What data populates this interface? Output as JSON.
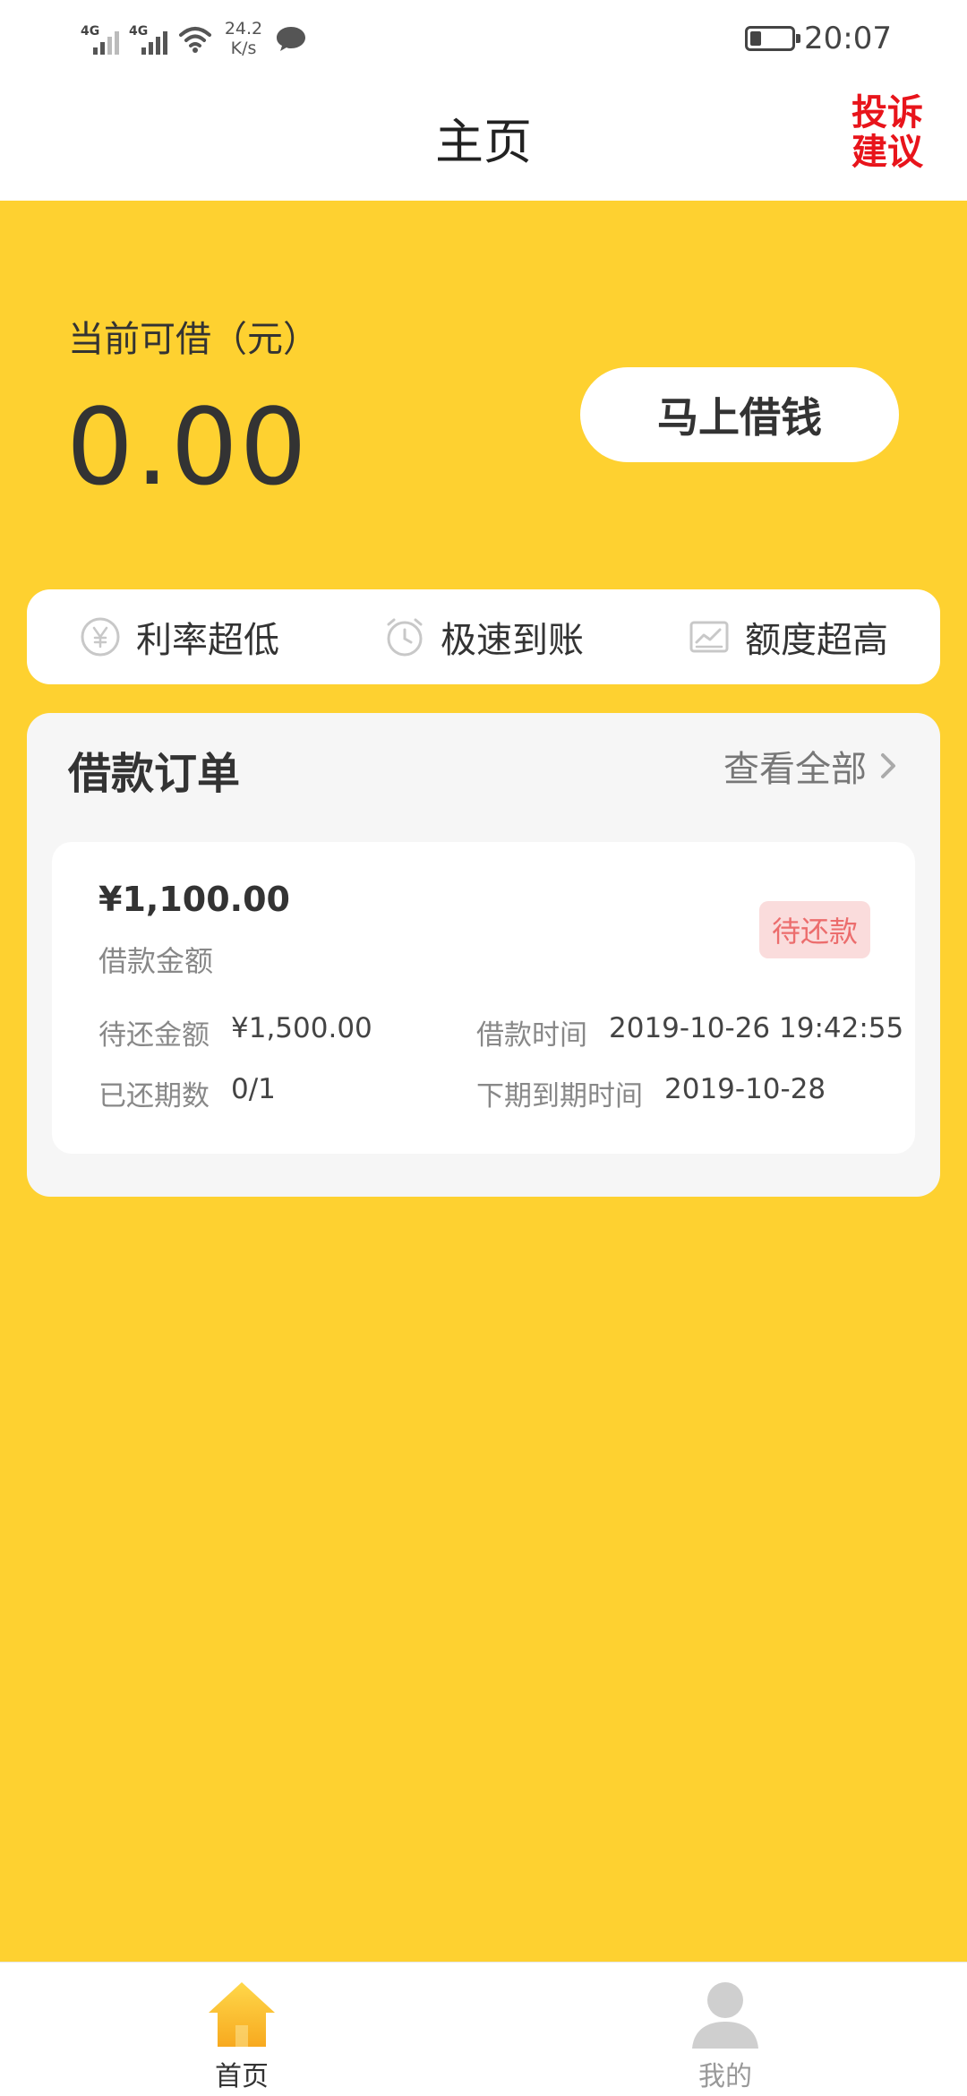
{
  "status_bar": {
    "net1": "4G",
    "net2": "4G",
    "speed_value": "24.2",
    "speed_unit": "K/s",
    "time": "20:07"
  },
  "header": {
    "title": "主页",
    "complaint_line1": "投诉",
    "complaint_line2": "建议"
  },
  "credit": {
    "label": "当前可借（元）",
    "amount": "0.00",
    "borrow_button": "马上借钱"
  },
  "features": [
    {
      "label": "利率超低",
      "icon": "yen-icon"
    },
    {
      "label": "极速到账",
      "icon": "clock-icon"
    },
    {
      "label": "额度超高",
      "icon": "chart-icon"
    }
  ],
  "orders": {
    "title": "借款订单",
    "view_all": "查看全部",
    "item": {
      "amount": "¥1,100.00",
      "amount_label": "借款金额",
      "status": "待还款",
      "pending_label": "待还金额",
      "pending_value": "¥1,500.00",
      "time_label": "借款时间",
      "time_value": "2019-10-26 19:42:55",
      "periods_label": "已还期数",
      "periods_value": "0/1",
      "due_label": "下期到期时间",
      "due_value": "2019-10-28"
    }
  },
  "nav": {
    "home": "首页",
    "mine": "我的"
  },
  "colors": {
    "accent": "#fed130",
    "complaint": "#e8141b",
    "status_bg": "#fadcdc",
    "status_text": "#ec6d6d"
  }
}
